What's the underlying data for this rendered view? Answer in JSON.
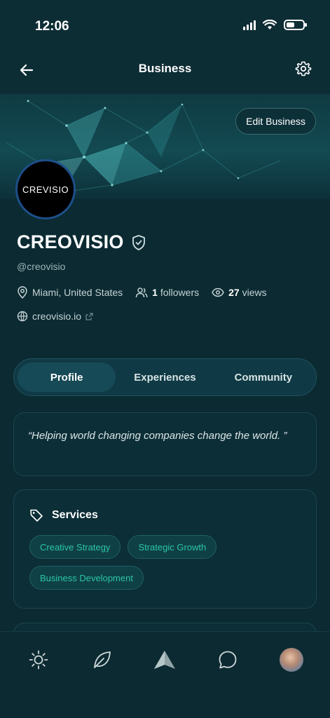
{
  "status_bar": {
    "time": "12:06"
  },
  "header": {
    "title": "Business"
  },
  "cover": {
    "edit_label": "Edit Business"
  },
  "profile": {
    "avatar_text": "CREVISIO",
    "name": "CREOVISIO",
    "handle": "@creovisio",
    "location": "Miami, United States",
    "followers_count": "1",
    "followers_label": "followers",
    "views_count": "27",
    "views_label": "views",
    "website": "creovisio.io"
  },
  "tabs": [
    {
      "label": "Profile",
      "active": true
    },
    {
      "label": "Experiences",
      "active": false
    },
    {
      "label": "Community",
      "active": false
    }
  ],
  "about": {
    "quote": "“Helping world changing companies change the world. ”"
  },
  "services": {
    "title": "Services",
    "items": [
      "Creative Strategy",
      "Strategic Growth",
      "Business Development"
    ]
  },
  "bottom_nav": [
    "sun-icon",
    "leaf-icon",
    "triangle-logo-icon",
    "chat-icon",
    "user-avatar"
  ],
  "colors": {
    "background": "#0b2a32",
    "accent": "#2cc5a8",
    "avatar_ring": "#1d4f8a"
  }
}
